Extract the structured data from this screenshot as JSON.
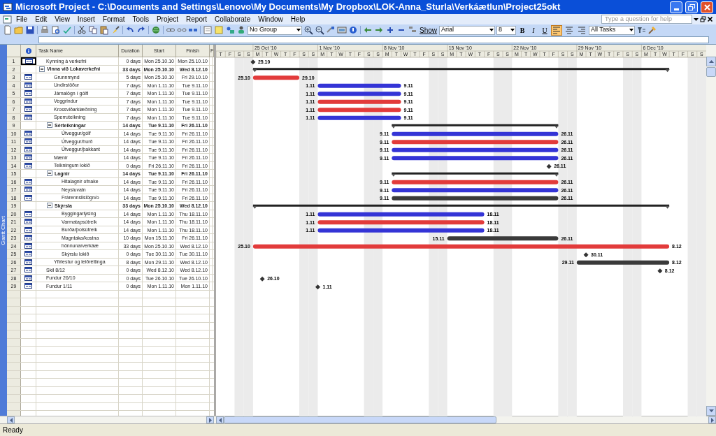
{
  "window": {
    "title": "Microsoft Project - C:\\Documents and Settings\\Lenovo\\My Documents\\My Dropbox\\LOK-Anna_Sturla\\Verkáætlun\\Project25okt"
  },
  "menu": [
    "File",
    "Edit",
    "View",
    "Insert",
    "Format",
    "Tools",
    "Project",
    "Report",
    "Collaborate",
    "Window",
    "Help"
  ],
  "help_box": {
    "placeholder": "Type a question for help"
  },
  "toolbar": {
    "group": "No Group",
    "show": "Show",
    "font": "Arial",
    "font_size": "8",
    "bold": "B",
    "italic": "I",
    "underline": "U",
    "align": [
      {
        "selected": true
      },
      {
        "selected": false
      },
      {
        "selected": false
      }
    ],
    "filter": "All Tasks"
  },
  "view_bar": "Gantt Chart",
  "columns": [
    "Task Name",
    "Duration",
    "Start",
    "Finish",
    "F"
  ],
  "timescale": {
    "weeks": [
      "25 Oct '10",
      "1 Nov '10",
      "8 Nov '10",
      "15 Nov '10",
      "22 Nov '10",
      "29 Nov '10",
      "6 Dec '10"
    ],
    "days": [
      "T",
      "F",
      "S",
      "S",
      "M",
      "T",
      "W",
      "T",
      "F",
      "S",
      "S",
      "M",
      "T",
      "W",
      "T",
      "F",
      "S",
      "S",
      "M",
      "T",
      "W",
      "T",
      "F",
      "S",
      "S",
      "M",
      "T",
      "W",
      "T",
      "F",
      "S",
      "S",
      "M",
      "T",
      "W",
      "T",
      "F",
      "S",
      "S",
      "M",
      "T",
      "W",
      "T",
      "F",
      "S",
      "S",
      "M",
      "T",
      "W",
      "T",
      "F",
      "S",
      "S"
    ]
  },
  "tasks": [
    {
      "id": "1",
      "name": "Kynning á verkefni",
      "kind": "milestone",
      "indicator": true,
      "selected": true,
      "duration": "0 days",
      "start": "Mon 25.10.10",
      "finish": "Mon 25.10.10",
      "labels": [
        "25.10"
      ]
    },
    {
      "id": "2",
      "name": "Vinna við Lokaverkefni",
      "kind": "summary",
      "indicator": false,
      "selected": false,
      "expanded": true,
      "duration": "33 days",
      "start": "Mon 25.10.10",
      "finish": "Wed 8.12.10",
      "children": [
        {
          "id": "3",
          "name": "Grunnmynd",
          "kind": "task",
          "indicator": true,
          "selected": false,
          "duration": "5 days",
          "start": "Mon 25.10.10",
          "finish": "Fri 29.10.10",
          "color": "#e23b3b",
          "labels": [
            "25.10",
            "29.10"
          ]
        },
        {
          "id": "4",
          "name": "Undirstöður",
          "kind": "task",
          "indicator": true,
          "selected": false,
          "duration": "7 days",
          "start": "Mon 1.11.10",
          "finish": "Tue 9.11.10",
          "color": "#3434d6",
          "labels": [
            "1.11",
            "9.11"
          ]
        },
        {
          "id": "5",
          "name": "Járnalögn í gólfi",
          "kind": "task",
          "indicator": true,
          "selected": false,
          "duration": "7 days",
          "start": "Mon 1.11.10",
          "finish": "Tue 9.11.10",
          "color": "#3434d6",
          "labels": [
            "1.11",
            "9.11"
          ]
        },
        {
          "id": "6",
          "name": "Veggrindur",
          "kind": "task",
          "indicator": true,
          "selected": false,
          "duration": "7 days",
          "start": "Mon 1.11.10",
          "finish": "Tue 9.11.10",
          "color": "#e23b3b",
          "labels": [
            "1.11",
            "9.11"
          ]
        },
        {
          "id": "7",
          "name": "Krossviðarklæðning",
          "kind": "task",
          "indicator": true,
          "selected": false,
          "duration": "7 days",
          "start": "Mon 1.11.10",
          "finish": "Tue 9.11.10",
          "color": "#e23b3b",
          "labels": [
            "1.11",
            "9.11"
          ]
        },
        {
          "id": "8",
          "name": "Sperruteikning",
          "kind": "task",
          "indicator": true,
          "selected": false,
          "duration": "7 days",
          "start": "Mon 1.11.10",
          "finish": "Tue 9.11.10",
          "color": "#3434d6",
          "labels": [
            "1.11",
            "9.11"
          ]
        },
        {
          "id": "9",
          "name": "Sérteikningar",
          "kind": "summary",
          "indicator": false,
          "selected": false,
          "expanded": true,
          "duration": "14 days",
          "start": "Tue 9.11.10",
          "finish": "Fri 26.11.10",
          "children": [
            {
              "id": "10",
              "name": "Útveggur/gólf",
              "kind": "task",
              "indicator": true,
              "selected": false,
              "duration": "14 days",
              "start": "Tue 9.11.10",
              "finish": "Fri 26.11.10",
              "color": "#3434d6",
              "labels": [
                "9.11",
                "26.11"
              ]
            },
            {
              "id": "11",
              "name": "Útveggur/hurð",
              "kind": "task",
              "indicator": true,
              "selected": false,
              "duration": "14 days",
              "start": "Tue 9.11.10",
              "finish": "Fri 26.11.10",
              "color": "#e23b3b",
              "labels": [
                "9.11",
                "26.11"
              ]
            },
            {
              "id": "12",
              "name": "Útveggur/þakkant",
              "kind": "task",
              "indicator": true,
              "selected": false,
              "duration": "14 days",
              "start": "Tue 9.11.10",
              "finish": "Fri 26.11.10",
              "color": "#3434d6",
              "labels": [
                "9.11",
                "26.11"
              ]
            }
          ]
        },
        {
          "id": "13",
          "name": "Mænir",
          "kind": "task",
          "indicator": true,
          "selected": false,
          "duration": "14 days",
          "start": "Tue 9.11.10",
          "finish": "Fri 26.11.10",
          "color": "#3434d6",
          "labels": [
            "9.11",
            "26.11"
          ]
        },
        {
          "id": "14",
          "name": "Teikningum lokið",
          "kind": "milestone",
          "indicator": true,
          "selected": false,
          "duration": "0 days",
          "start": "Fri 26.11.10",
          "finish": "Fri 26.11.10",
          "labels": [
            "26.11"
          ]
        },
        {
          "id": "15",
          "name": "Lagnir",
          "kind": "summary",
          "indicator": false,
          "selected": false,
          "expanded": true,
          "duration": "14 days",
          "start": "Tue 9.11.10",
          "finish": "Fri 26.11.10",
          "children": [
            {
              "id": "16",
              "name": "Hitalagnir ofnake",
              "kind": "task",
              "indicator": true,
              "selected": false,
              "duration": "14 days",
              "start": "Tue 9.11.10",
              "finish": "Fri 26.11.10",
              "color": "#e23b3b",
              "labels": [
                "9.11",
                "26.11"
              ]
            },
            {
              "id": "17",
              "name": "Neysluvatn",
              "kind": "task",
              "indicator": true,
              "selected": false,
              "duration": "14 days",
              "start": "Tue 9.11.10",
              "finish": "Fri 26.11.10",
              "color": "#3434d6",
              "labels": [
                "9.11",
                "26.11"
              ]
            },
            {
              "id": "18",
              "name": "Frárennslislögn/o",
              "kind": "task",
              "indicator": true,
              "selected": false,
              "duration": "14 days",
              "start": "Tue 9.11.10",
              "finish": "Fri 26.11.10",
              "color": "#3a3a3a",
              "labels": [
                "9.11",
                "26.11"
              ]
            }
          ]
        },
        {
          "id": "19",
          "name": "Skýrsla",
          "kind": "summary",
          "indicator": false,
          "selected": false,
          "expanded": true,
          "duration": "33 days",
          "start": "Mon 25.10.10",
          "finish": "Wed 8.12.10",
          "children": [
            {
              "id": "20",
              "name": "Byggingarlýsing",
              "kind": "task",
              "indicator": true,
              "selected": false,
              "duration": "14 days",
              "start": "Mon 1.11.10",
              "finish": "Thu 18.11.10",
              "color": "#3434d6",
              "labels": [
                "1.11",
                "18.11"
              ]
            },
            {
              "id": "21",
              "name": "Varmatapsútreik",
              "kind": "task",
              "indicator": true,
              "selected": false,
              "duration": "14 days",
              "start": "Mon 1.11.10",
              "finish": "Thu 18.11.10",
              "color": "#e23b3b",
              "labels": [
                "1.11",
                "18.11"
              ]
            },
            {
              "id": "22",
              "name": "Burðarþolsútreik",
              "kind": "task",
              "indicator": true,
              "selected": false,
              "duration": "14 days",
              "start": "Mon 1.11.10",
              "finish": "Thu 18.11.10",
              "color": "#3434d6",
              "labels": [
                "1.11",
                "18.11"
              ]
            },
            {
              "id": "23",
              "name": "Magntaka/kostna",
              "kind": "task",
              "indicator": true,
              "selected": false,
              "duration": "10 days",
              "start": "Mon 15.11.10",
              "finish": "Fri 26.11.10",
              "color": "#3a3a3a",
              "labels": [
                "15.11",
                "26.11"
              ]
            },
            {
              "id": "24",
              "name": "hönnunarverkáæ",
              "kind": "task",
              "indicator": true,
              "selected": false,
              "duration": "33 days",
              "start": "Mon 25.10.10",
              "finish": "Wed 8.12.10",
              "color": "#e23b3b",
              "labels": [
                "25.10",
                "8.12"
              ]
            },
            {
              "id": "25",
              "name": "Skýrslu lokið",
              "kind": "milestone",
              "indicator": true,
              "selected": false,
              "duration": "0 days",
              "start": "Tue 30.11.10",
              "finish": "Tue 30.11.10",
              "labels": [
                "30.11"
              ]
            }
          ]
        },
        {
          "id": "26",
          "name": "Yfirlestur og leiðréttinga",
          "kind": "task",
          "indicator": true,
          "selected": false,
          "duration": "8 days",
          "start": "Mon 29.11.10",
          "finish": "Wed 8.12.10",
          "color": "#3a3a3a",
          "labels": [
            "29.11",
            "8.12"
          ]
        }
      ]
    },
    {
      "id": "27",
      "name": "Skil 8/12",
      "kind": "milestone",
      "indicator": true,
      "selected": false,
      "duration": "0 days",
      "start": "Wed 8.12.10",
      "finish": "Wed 8.12.10",
      "labels": [
        "8.12"
      ]
    },
    {
      "id": "28",
      "name": "Fundur 26/10",
      "kind": "milestone",
      "indicator": true,
      "selected": false,
      "duration": "0 days",
      "start": "Tue 26.10.10",
      "finish": "Tue 26.10.10",
      "labels": [
        "26.10"
      ]
    },
    {
      "id": "29",
      "name": "Fundur 1/11",
      "kind": "milestone",
      "indicator": true,
      "selected": false,
      "duration": "0 days",
      "start": "Mon 1.11.10",
      "finish": "Mon 1.11.10",
      "labels": [
        "1.11"
      ]
    }
  ],
  "status_bar": "Ready"
}
